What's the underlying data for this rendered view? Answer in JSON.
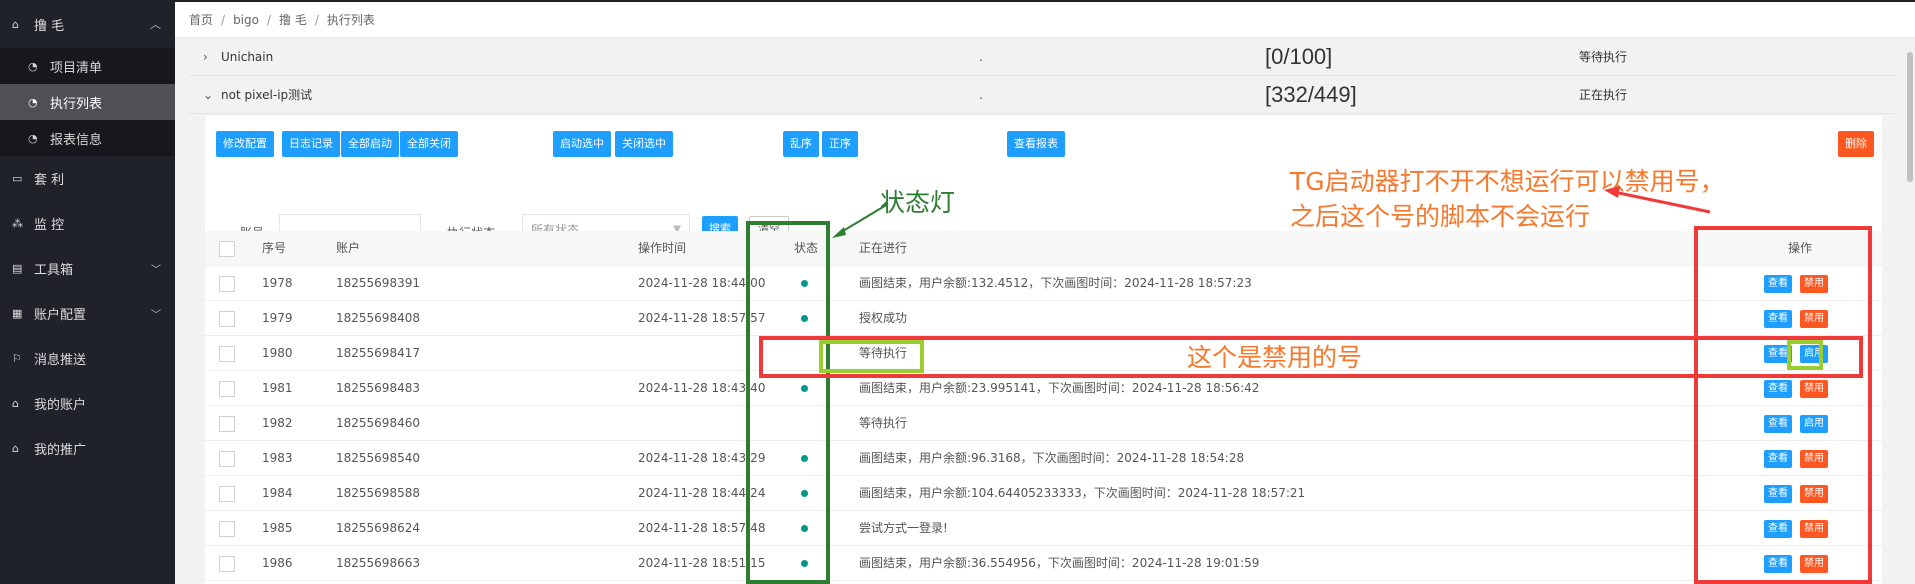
{
  "sidebar": {
    "group": {
      "label": "撸 毛",
      "icon": "home-icon",
      "arrow": "chevron-up-icon"
    },
    "subitems": [
      {
        "label": "项目清单",
        "icon": "dashboard-icon"
      },
      {
        "label": "执行列表",
        "icon": "dashboard-icon",
        "active": true
      },
      {
        "label": "报表信息",
        "icon": "dashboard-icon"
      }
    ],
    "items": [
      {
        "label": "套 利",
        "icon": "window-icon"
      },
      {
        "label": "监 控",
        "icon": "cluster-icon"
      },
      {
        "label": "工具箱",
        "icon": "file-icon",
        "arrow": "chevron-down-icon"
      },
      {
        "label": "账户配置",
        "icon": "calendar-icon",
        "arrow": "chevron-down-icon"
      },
      {
        "label": "消息推送",
        "icon": "flag-icon"
      },
      {
        "label": "我的账户",
        "icon": "home-icon"
      },
      {
        "label": "我的推广",
        "icon": "home-icon"
      }
    ]
  },
  "breadcrumb": [
    "首页",
    "bigo",
    "撸 毛",
    "执行列表"
  ],
  "tree": [
    {
      "toggle": "›",
      "name": "Unichain",
      "dot": ".",
      "progress": "[0/100]",
      "status": "等待执行"
    },
    {
      "toggle": "⌄",
      "name": "not pixel-ip测试",
      "dot": ".",
      "progress": "[332/449]",
      "status": "正在执行"
    }
  ],
  "toolbar": {
    "buttons": [
      "修改配置",
      "日志记录",
      "全部启动",
      "全部关闭",
      "启动选中",
      "关闭选中",
      "乱序",
      "正序",
      "查看报表",
      "删除"
    ],
    "account_label": "账号",
    "state_label": "执行状态",
    "state_placeholder": "所有状态",
    "search": "搜索",
    "clear": "清空"
  },
  "table": {
    "headers": [
      "序号",
      "账户",
      "操作时间",
      "状态",
      "正在进行",
      "操作"
    ],
    "rows": [
      {
        "seq": "1978",
        "account": "18255698391",
        "time": "2024-11-28 18:44:00",
        "dot": true,
        "progress": "画图结束，用户余额:132.4512，下次画图时间：2024-11-28 18:57:23",
        "view": "查看",
        "action": "禁用",
        "action_color": "#ff5722"
      },
      {
        "seq": "1979",
        "account": "18255698408",
        "time": "2024-11-28 18:57:57",
        "dot": true,
        "progress": "授权成功",
        "view": "查看",
        "action": "禁用",
        "action_color": "#ff5722"
      },
      {
        "seq": "1980",
        "account": "18255698417",
        "time": "",
        "dot": false,
        "progress": "等待执行",
        "view": "查看",
        "action": "启用",
        "action_color": "#1e9fff"
      },
      {
        "seq": "1981",
        "account": "18255698483",
        "time": "2024-11-28 18:43:40",
        "dot": true,
        "progress": "画图结束，用户余额:23.995141，下次画图时间：2024-11-28 18:56:42",
        "view": "查看",
        "action": "禁用",
        "action_color": "#ff5722"
      },
      {
        "seq": "1982",
        "account": "18255698460",
        "time": "",
        "dot": false,
        "progress": "等待执行",
        "view": "查看",
        "action": "启用",
        "action_color": "#1e9fff"
      },
      {
        "seq": "1983",
        "account": "18255698540",
        "time": "2024-11-28 18:43:29",
        "dot": true,
        "progress": "画图结束，用户余额:96.3168，下次画图时间：2024-11-28 18:54:28",
        "view": "查看",
        "action": "禁用",
        "action_color": "#ff5722"
      },
      {
        "seq": "1984",
        "account": "18255698588",
        "time": "2024-11-28 18:44:24",
        "dot": true,
        "progress": "画图结束，用户余额:104.64405233333，下次画图时间：2024-11-28 18:57:21",
        "view": "查看",
        "action": "禁用",
        "action_color": "#ff5722"
      },
      {
        "seq": "1985",
        "account": "18255698624",
        "time": "2024-11-28 18:57:48",
        "dot": true,
        "progress": "尝试方式一登录!",
        "view": "查看",
        "action": "禁用",
        "action_color": "#ff5722"
      },
      {
        "seq": "1986",
        "account": "18255698663",
        "time": "2024-11-28 18:51:15",
        "dot": true,
        "progress": "画图结束，用户余额:36.554956，下次画图时间：2024-11-28 19:01:59",
        "view": "查看",
        "action": "禁用",
        "action_color": "#ff5722"
      }
    ]
  },
  "annotations": {
    "status_light": "状态灯",
    "tg_note_line1": "TG启动器打不开不想运行可以禁用号，",
    "tg_note_line2": "之后这个号的脚本不会运行",
    "disabled_note": "这个是禁用的号",
    "color_green": "#2e7d32",
    "color_red": "#f03a3a",
    "color_lime": "#9acd32",
    "color_orange": "#f5782d"
  }
}
